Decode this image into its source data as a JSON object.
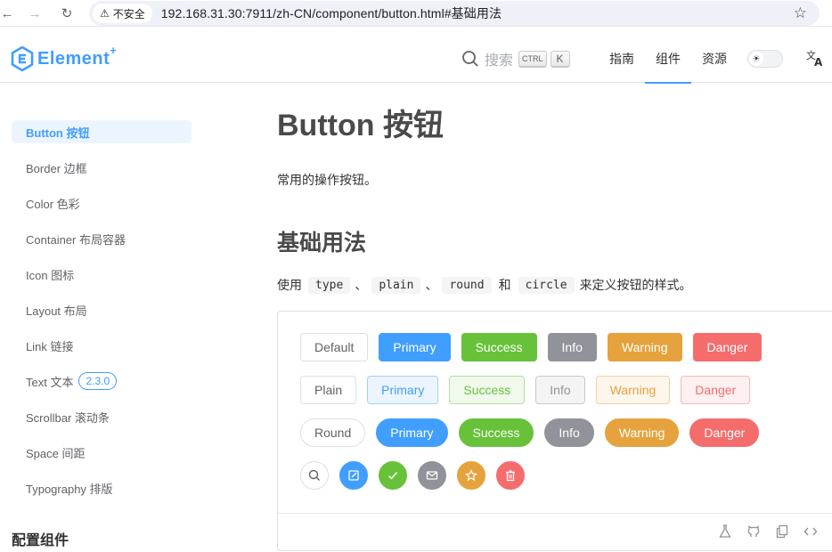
{
  "browser": {
    "security_label": "不安全",
    "url": "192.168.31.30:7911/zh-CN/component/button.html#基础用法"
  },
  "header": {
    "logo_text": "Element",
    "logo_plus": "+",
    "search_label": "搜索",
    "kbd_ctrl": "CTRL",
    "kbd_k": "K",
    "nav": [
      "指南",
      "组件",
      "资源"
    ],
    "active_nav": "组件",
    "lang_icon": "文A"
  },
  "sidebar": {
    "items": [
      {
        "label": "Button 按钮",
        "active": true
      },
      {
        "label": "Border 边框"
      },
      {
        "label": "Color 色彩"
      },
      {
        "label": "Container 布局容器"
      },
      {
        "label": "Icon 图标"
      },
      {
        "label": "Layout 布局"
      },
      {
        "label": "Link 链接"
      },
      {
        "label": "Text 文本",
        "badge": "2.3.0"
      },
      {
        "label": "Scrollbar 滚动条"
      },
      {
        "label": "Space 间距"
      },
      {
        "label": "Typography 排版"
      }
    ],
    "group_title": "配置组件"
  },
  "main": {
    "title": "Button 按钮",
    "description": "常用的操作按钮。",
    "section_title": "基础用法",
    "usage": {
      "prefix": "使用",
      "codes": [
        "type",
        "plain",
        "round",
        "circle"
      ],
      "sep": "、",
      "and": "和",
      "suffix": "来定义按钮的样式。"
    }
  },
  "demo": {
    "row1": [
      "Default",
      "Primary",
      "Success",
      "Info",
      "Warning",
      "Danger"
    ],
    "row2": [
      "Plain",
      "Primary",
      "Success",
      "Info",
      "Warning",
      "Danger"
    ],
    "row3": [
      "Round",
      "Primary",
      "Success",
      "Info",
      "Warning",
      "Danger"
    ],
    "row4_icons": [
      "search-icon",
      "edit-icon",
      "check-icon",
      "message-icon",
      "star-icon",
      "delete-icon"
    ],
    "toolbar_icons": [
      "playground-icon",
      "github-icon",
      "copy-icon",
      "view-source-icon"
    ]
  },
  "colors": {
    "primary": "#409eff",
    "success": "#67c23a",
    "info": "#909399",
    "warning": "#e6a23c",
    "danger": "#f56c6c"
  }
}
